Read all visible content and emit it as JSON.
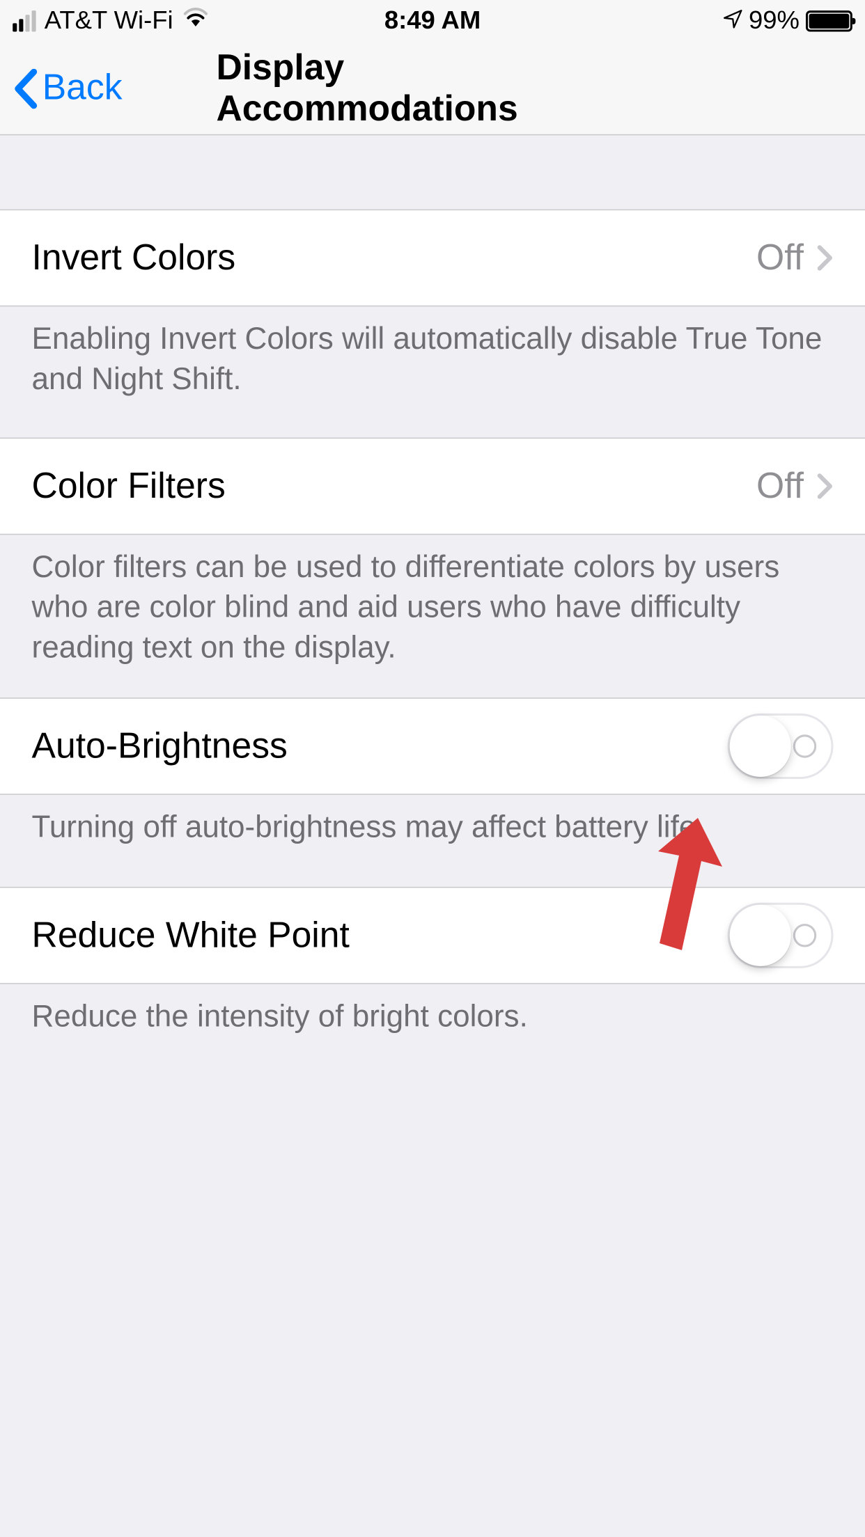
{
  "status_bar": {
    "carrier": "AT&T Wi-Fi",
    "time": "8:49 AM",
    "battery_percent": "99%"
  },
  "nav": {
    "back_label": "Back",
    "title": "Display Accommodations"
  },
  "sections": {
    "invert_colors": {
      "label": "Invert Colors",
      "value": "Off",
      "footer": "Enabling Invert Colors will automatically disable True Tone and Night Shift."
    },
    "color_filters": {
      "label": "Color Filters",
      "value": "Off",
      "footer": "Color filters can be used to differentiate colors by users who are color blind and aid users who have difficulty reading text on the display."
    },
    "auto_brightness": {
      "label": "Auto-Brightness",
      "toggle": false,
      "footer": "Turning off auto-brightness may affect battery life."
    },
    "reduce_white_point": {
      "label": "Reduce White Point",
      "toggle": false,
      "footer": "Reduce the intensity of bright colors."
    }
  },
  "annotation": {
    "color": "#d93a3a"
  }
}
